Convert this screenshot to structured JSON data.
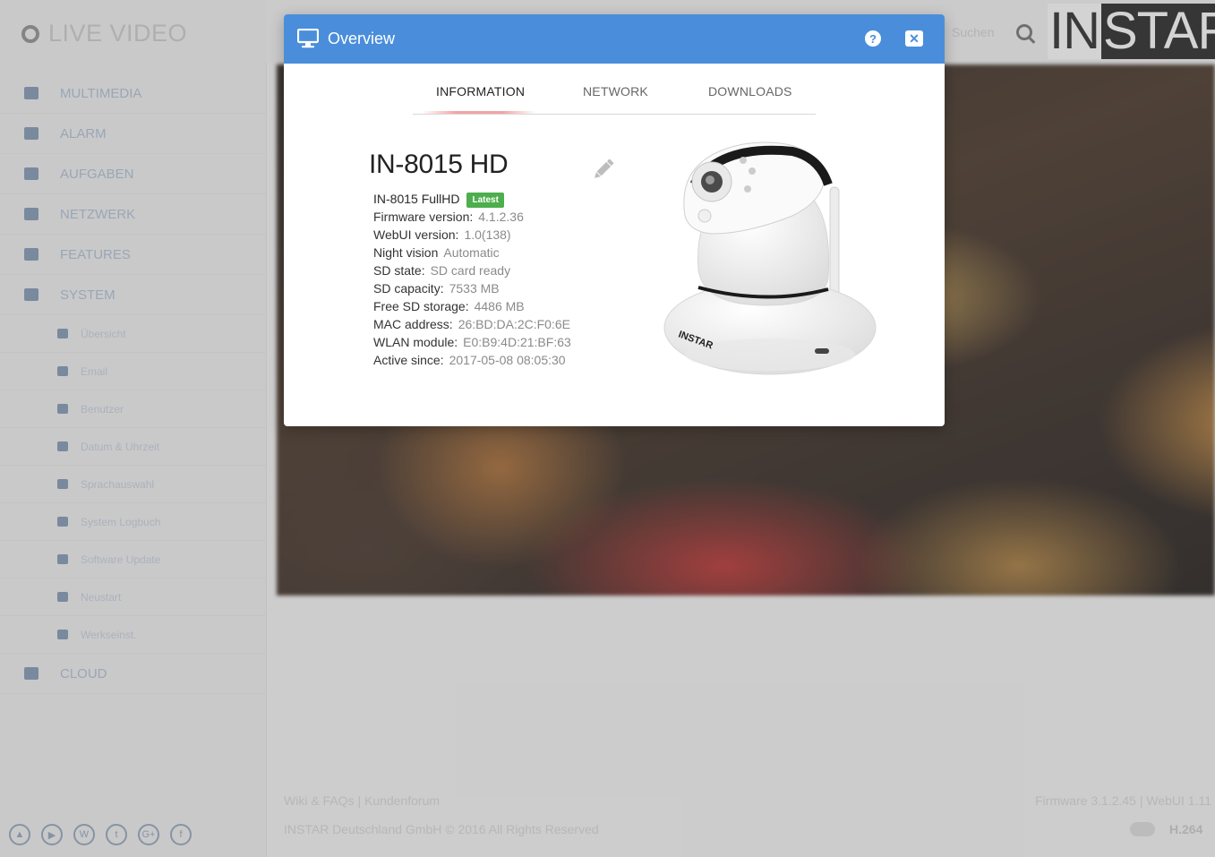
{
  "app": {
    "brand": "LIVE VIDEO",
    "nav": [
      {
        "label": "MULTIMEDIA"
      },
      {
        "label": "ALARM"
      },
      {
        "label": "AUFGABEN"
      },
      {
        "label": "NETZWERK"
      },
      {
        "label": "FEATURES"
      },
      {
        "label": "SYSTEM"
      }
    ],
    "system_sub": [
      {
        "label": "Übersicht"
      },
      {
        "label": "Email"
      },
      {
        "label": "Benutzer"
      },
      {
        "label": "Datum & Uhrzeit"
      },
      {
        "label": "Sprachauswahl"
      },
      {
        "label": "System Logbuch"
      },
      {
        "label": "Software Update"
      },
      {
        "label": "Neustart"
      },
      {
        "label": "Werkseinst."
      }
    ],
    "cloud": "CLOUD",
    "search_placeholder": "Suchen",
    "logo_left": "IN",
    "logo_right": "STAR",
    "footer": {
      "links": "Wiki & FAQs | Kundenforum",
      "copyright": "INSTAR Deutschland GmbH © 2016 All Rights Reserved",
      "firmware": "Firmware 3.1.2.45 | WebUI 1.11",
      "codec": "H.264"
    },
    "social_icons": [
      "instar-icon",
      "youtube-icon",
      "wordpress-icon",
      "twitter-icon",
      "google-plus-icon",
      "facebook-icon"
    ]
  },
  "modal": {
    "title": "Overview",
    "help_label": "?",
    "close_label": "✕",
    "tabs": [
      "INFORMATION",
      "NETWORK",
      "DOWNLOADS"
    ],
    "active_tab": "INFORMATION",
    "model": "IN-8015 HD",
    "variant": "IN-8015 FullHD",
    "badge": "Latest",
    "badge_color": "#4cae4c",
    "header_color": "#4a8edb",
    "info": [
      {
        "key": "Firmware version:",
        "value": "4.1.2.36"
      },
      {
        "key": "WebUI version:",
        "value": "1.0(138)"
      },
      {
        "key": "Night vision",
        "value": "Automatic"
      },
      {
        "key": "SD state:",
        "value": "SD card ready"
      },
      {
        "key": "SD capacity:",
        "value": "7533 MB"
      },
      {
        "key": "Free SD storage:",
        "value": "4486 MB"
      },
      {
        "key": "MAC address:",
        "value": "26:BD:DA:2C:F0:6E"
      },
      {
        "key": "WLAN module:",
        "value": "E0:B9:4D:21:BF:63"
      },
      {
        "key": "Active since:",
        "value": "2017-05-08 08:05:30"
      }
    ],
    "camera_label": "INSTAR"
  }
}
